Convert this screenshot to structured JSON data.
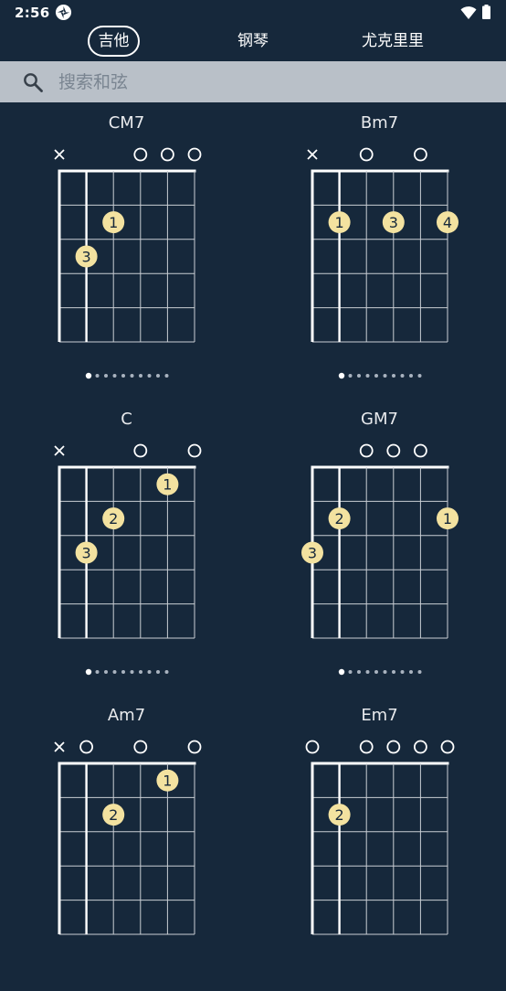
{
  "status_bar": {
    "time": "2:56"
  },
  "tabs": [
    {
      "label": "吉他",
      "active": true
    },
    {
      "label": "钢琴",
      "active": false
    },
    {
      "label": "尤克里里",
      "active": false
    }
  ],
  "search": {
    "placeholder": "搜索和弦",
    "value": ""
  },
  "colors": {
    "background": "#16283b",
    "finger_dot": "#f3e2a0",
    "search_bar": "#b9c0c8"
  },
  "pager": {
    "total_variations": 10,
    "current_index": 0
  },
  "chords": [
    {
      "name": "CM7",
      "markers": [
        "x",
        "",
        "",
        "o",
        "o",
        "o"
      ],
      "fingers": [
        {
          "string": 3,
          "fret": 2,
          "label": "1"
        },
        {
          "string": 2,
          "fret": 3,
          "label": "3"
        }
      ]
    },
    {
      "name": "Bm7",
      "markers": [
        "x",
        "",
        "o",
        "",
        "o",
        ""
      ],
      "fingers": [
        {
          "string": 2,
          "fret": 2,
          "label": "1"
        },
        {
          "string": 4,
          "fret": 2,
          "label": "3"
        },
        {
          "string": 6,
          "fret": 2,
          "label": "4"
        }
      ]
    },
    {
      "name": "C",
      "markers": [
        "x",
        "",
        "",
        "o",
        "",
        "o"
      ],
      "fingers": [
        {
          "string": 5,
          "fret": 1,
          "label": "1"
        },
        {
          "string": 3,
          "fret": 2,
          "label": "2"
        },
        {
          "string": 2,
          "fret": 3,
          "label": "3"
        }
      ]
    },
    {
      "name": "GM7",
      "markers": [
        "",
        "",
        "o",
        "o",
        "o",
        ""
      ],
      "fingers": [
        {
          "string": 2,
          "fret": 2,
          "label": "2"
        },
        {
          "string": 6,
          "fret": 2,
          "label": "1"
        },
        {
          "string": 1,
          "fret": 3,
          "label": "3"
        }
      ]
    },
    {
      "name": "Am7",
      "markers": [
        "x",
        "o",
        "",
        "o",
        "",
        "o"
      ],
      "fingers": [
        {
          "string": 5,
          "fret": 1,
          "label": "1"
        },
        {
          "string": 3,
          "fret": 2,
          "label": "2"
        }
      ]
    },
    {
      "name": "Em7",
      "markers": [
        "o",
        "",
        "o",
        "o",
        "o",
        "o"
      ],
      "fingers": [
        {
          "string": 2,
          "fret": 2,
          "label": "2"
        }
      ]
    }
  ]
}
